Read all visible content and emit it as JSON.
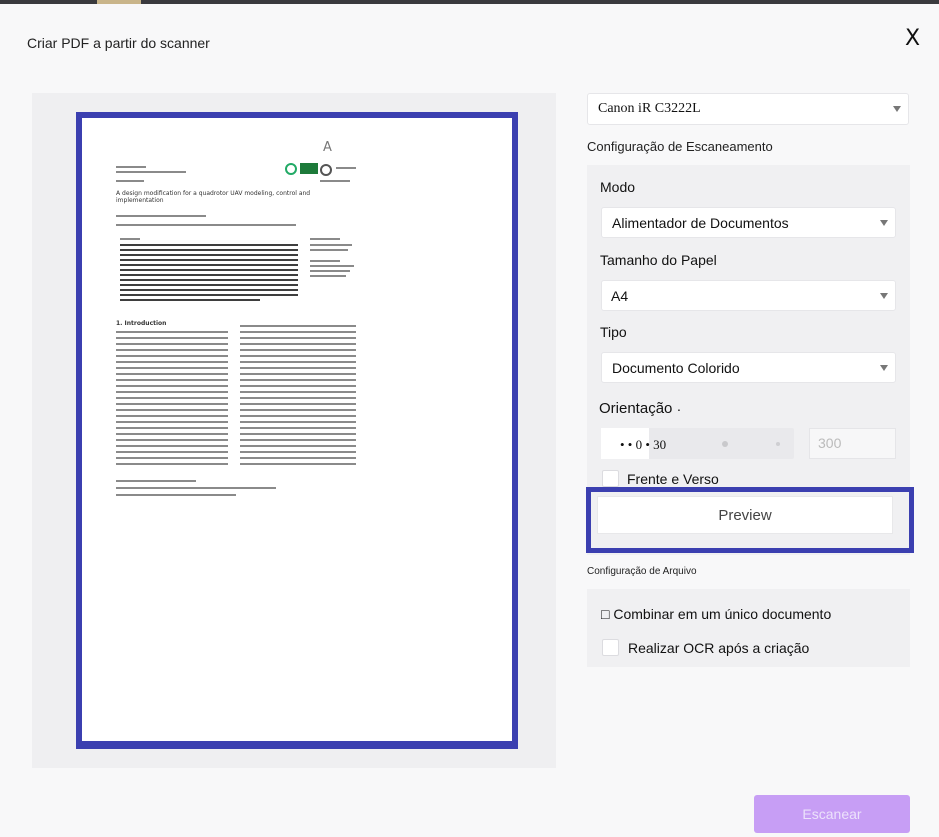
{
  "dialog": {
    "title": "Criar PDF a partir do scanner",
    "close_label": "X"
  },
  "document_preview": {
    "paper_title": "A design modification for a quadrotor UAV modeling, control and implementation",
    "section_heading": "1. Introduction",
    "logo_text": "A"
  },
  "scanner": {
    "selected": "Canon iR C3222L"
  },
  "scan_settings": {
    "section_label": "Configuração de Escaneamento",
    "mode": {
      "label": "Modo",
      "value": "Alimentador de Documentos"
    },
    "paper_size": {
      "label": "Tamanho do Papel",
      "value": "A4"
    },
    "type": {
      "label": "Tipo",
      "value": "Documento Colorido"
    },
    "orientation": {
      "label": "Orientação",
      "mark": "."
    },
    "resolution": {
      "slider_value": "• • 0 • 30",
      "input_value": "300"
    },
    "duplex": {
      "label": "Frente e Verso",
      "checked": false
    }
  },
  "preview_button": {
    "label": "Preview"
  },
  "file_settings": {
    "section_label": "Configuração de Arquivo",
    "combine": {
      "label": "□ Combinar em um único documento"
    },
    "ocr": {
      "label": "Realizar OCR após a criação",
      "checked": false
    }
  },
  "scan_button": {
    "label": "Escanear",
    "color": "#c79ef5"
  }
}
